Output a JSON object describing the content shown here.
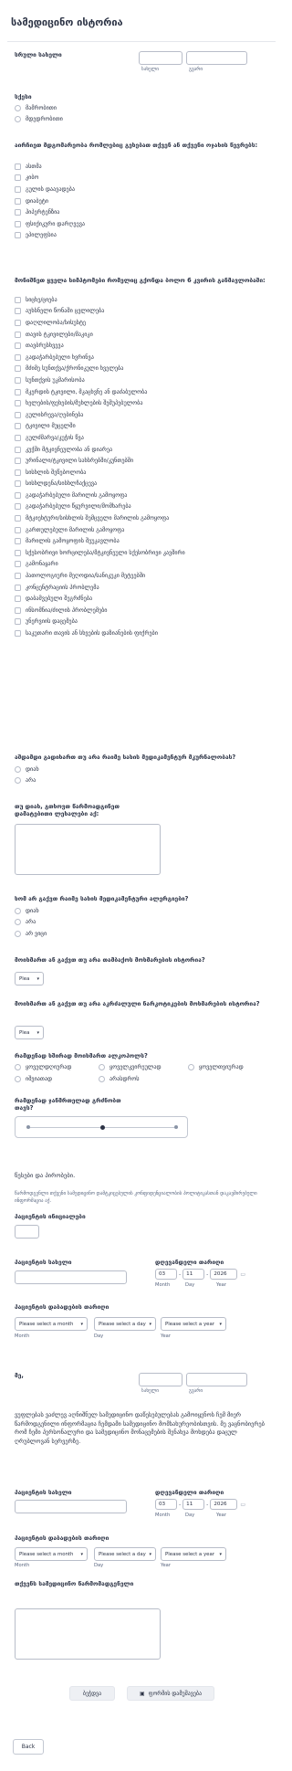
{
  "title": "სამედიცინო ისტორია",
  "full_name": {
    "label": "სრული სახელი",
    "first_sub": "სახელი",
    "last_sub": "გვარი"
  },
  "gender": {
    "label": "სქესი",
    "options": [
      "მამრობითი",
      "მდედრობითი"
    ]
  },
  "conditions": {
    "label": "აირჩიეთ მდგომარეობა რომლებიც გეხებათ თქვენ ან თქვენი ოჯახის წევრებს:",
    "options": [
      "ასთმა",
      "კიბო",
      "გულის დაავადება",
      "დიაბეტი",
      "ჰიპერტენზია",
      "ფსიქიკური დარღვევა",
      "ეპილეფსია"
    ]
  },
  "symptoms": {
    "label": "მონიშნეთ ყველა სიმპტომები რომელიც გქონდა ბოლო 6 კვირის განმავლობაში:",
    "options": [
      "სიცხე/ციება",
      "აუხსნელი წონაში ცვლილება",
      "დაღლილობა/სისუსტე",
      "თავის ტკივილები/მაკიკი",
      "თავბრუსხვევა",
      "გადაჭარბებული ხვრინვა",
      "მძიმე სუნთქვა/ქრონიკული ხველება",
      "სუნთქვის უკმარისობა",
      "მკერდის ტკივილი, მკაცხვნე ან დაძაბულობა",
      "ხელების/ფეხების/მუხლების შეშუპებულობა",
      "გულისრევა/ღებინება",
      "ტკივილი მუცელში",
      "გულძმარვა/კუჭის წვა",
      "კუჭში მტკივნეულობა ან დიარეა",
      "ურინალი/ტკივილი სახსრებში/კუნთებში",
      "სისხლის შეწებოლობა",
      "სისხლდენა/სისხლჩაქცევა",
      "გადაჭარბებული მარილის გამოყოფა",
      "გადაჭარბებული წყურვილი/მომხარება",
      "მტკიეხტური/სისხლის შემცველი მარილის გამოყოფა",
      "გართულებული მარილის გამოყოფა",
      "მარილის გამოყოფის შეუკავლობა",
      "სქესობრივი ხორცილება/მტკივნეული სქესობრივი კავშირი",
      "გამონაყარი",
      "პათოლოგიური მეღოდია/სანიკუკი მეტეებში",
      "კონცენტრაციის პრობლემა",
      "დაბამვებული შეგრძნება",
      "ინსომნია/ძილის პრობლემები",
      "უნერვიის დაცემება",
      "საკუთარი თავის ან სხვების დაზიანების ფიქრები"
    ]
  },
  "exposure": {
    "label": "აშდამდი გადიხართ თუ არა რაიმე სახის მედიკამენტურ მკურნალობას?",
    "options": [
      "დიახ",
      "არა"
    ]
  },
  "medications": {
    "label": "თუ დიახ, გთხოვთ წარმოადგინეთ დამატებითი ლეხალები აქ:"
  },
  "allergy": {
    "label": "ხომ არ გაქვთ რაიმე სახის მედიკამენტური ალერგიები?",
    "options": [
      "დიახ",
      "არა",
      "არ ვიცი"
    ]
  },
  "tobacco": {
    "label": "მოიხმართ ან გაქვთ თუ არა თამბაქოს მოხმარების ისტორია?",
    "placeholder": "Plea"
  },
  "drugs": {
    "label": "მოიხმართ ან გაქვთ თუ არა აკრძალული ნარკოტიკების მოხმარების ისტორია?",
    "placeholder": "Plea"
  },
  "alcohol": {
    "label": "რამდენად ხშირად მოიხმართ ალკოჰოლს?",
    "options": [
      "ყოველდღიურად",
      "ყოველკვირეულად",
      "ყოველთვიურად",
      "იშვიათად",
      "არასდროს"
    ]
  },
  "health": {
    "label": "რამდენად ჯანმრთელად გრძნობთ თავს?"
  },
  "terms_title": "წესები და პირობები.",
  "terms_text": "წარმოდგენლი თქვენი სამედიცინო დამტკიცებულის კონფიდენციალობის პოლიტიკასთან დაკავშირებული ინფორმაცია აქ.",
  "patient_initials": {
    "label": "პაციენტის ინიციალები"
  },
  "patient_name": {
    "label": "პაციენტის სახელი"
  },
  "date": {
    "label": "დღევანდელი თარიღი",
    "month": "03",
    "day": "11",
    "year": "2026",
    "month_sub": "Month",
    "day_sub": "Day",
    "year_sub": "Year"
  },
  "birth": {
    "label": "პაციენტის დაბადების თარიღი",
    "month_placeholder": "Please select a month",
    "day_placeholder": "Please select a day",
    "year_placeholder": "Please select a year",
    "month_sub": "Month",
    "day_sub": "Day",
    "year_sub": "Year"
  },
  "sig": {
    "label": "მე,",
    "first_sub": "სახელი",
    "last_sub": "გვარი"
  },
  "consent_text": "ვუფლებას ვაძლევ აღნიშნულ სამედიცინო დაწესებულებას გამოიყენოს ჩემ მიერ წარმოდგენილი ინფორმაცია ჩემდამი სამედიცინო მომსახურეობისთვის. მე ვაცნობიერებ რომ ჩემი პერსონალური და სამედიცინო მონაცემების შენახვა მოხდება დაცულ ღრუბლოვან სერვერზე.",
  "patient_name2": {
    "label": "პაციენტის სახელი"
  },
  "date2": {
    "label": "დღევანდელი თარიღი",
    "month": "03",
    "day": "11",
    "year": "2026",
    "month_sub": "Month",
    "day_sub": "Day",
    "year_sub": "Year"
  },
  "birth2": {
    "label": "პაციენტის დაბადების თარიღი",
    "month_placeholder": "Please select a month",
    "day_placeholder": "Please select a day",
    "year_placeholder": "Please select a year",
    "month_sub": "Month",
    "day_sub": "Day",
    "year_sub": "Year"
  },
  "signature": {
    "label": "თქვენს სამედიცინო წარმომადგენელი"
  },
  "buttons": {
    "print": "ბეჭდვა",
    "save": "ფორმის დამუშავება",
    "back": "Back"
  }
}
